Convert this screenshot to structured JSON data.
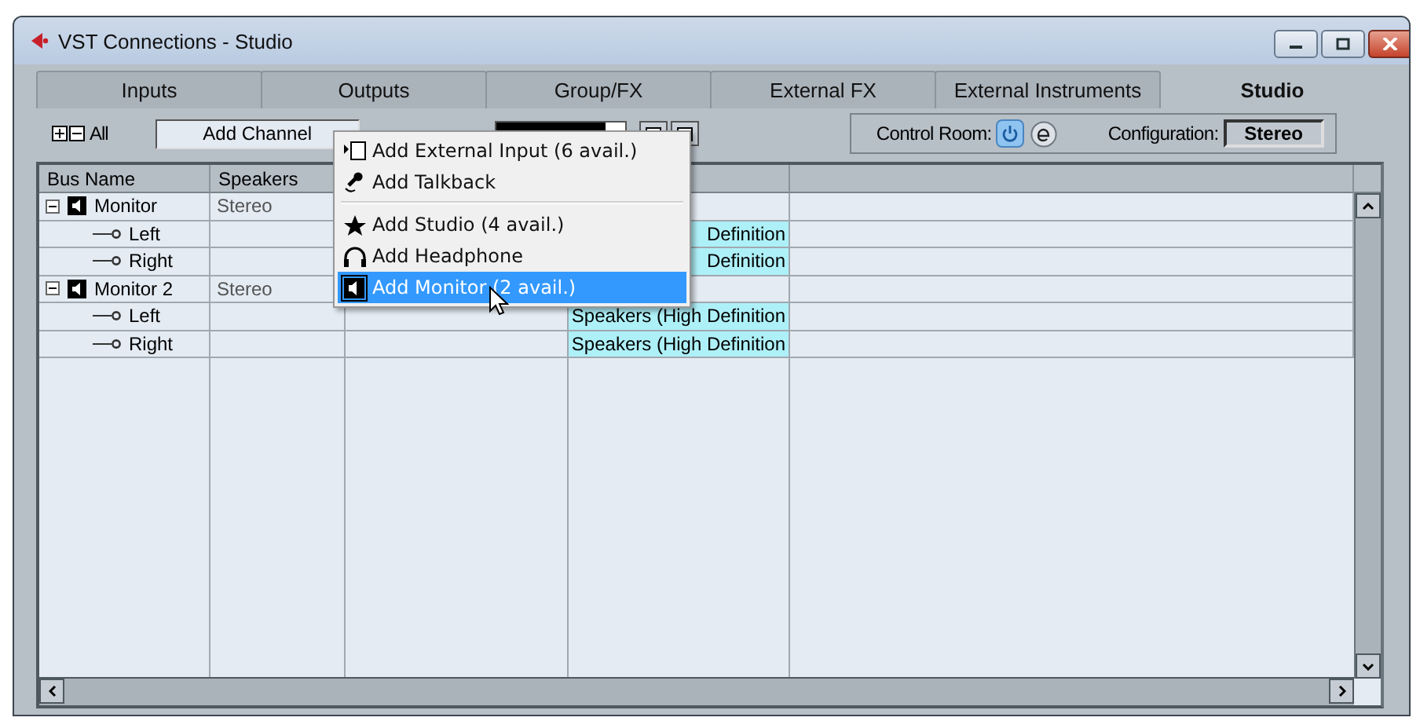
{
  "window": {
    "title": "VST Connections - Studio"
  },
  "tabs": [
    {
      "label": "Inputs",
      "selected": false
    },
    {
      "label": "Outputs",
      "selected": false
    },
    {
      "label": "Group/FX",
      "selected": false
    },
    {
      "label": "External FX",
      "selected": false
    },
    {
      "label": "External Instruments",
      "selected": false
    },
    {
      "label": "Studio",
      "selected": true
    }
  ],
  "toolbar": {
    "expand_all_label": "All",
    "add_button": "Add Channel",
    "control_room_label": "Control Room:",
    "control_room_on": true,
    "configuration_label": "Configuration:",
    "configuration_value": "Stereo"
  },
  "table": {
    "columns": [
      "Bus Name",
      "Speakers"
    ],
    "rows": [
      {
        "name": "Monitor",
        "speakers": "Stereo",
        "expanded": true,
        "children": [
          {
            "name": "Left",
            "column_4": "Definition"
          },
          {
            "name": "Right",
            "column_4": "Definition"
          }
        ]
      },
      {
        "name": "Monitor 2",
        "speakers": "Stereo",
        "expanded": true,
        "children": [
          {
            "name": "Left",
            "column_4": "Speakers (High Definition"
          },
          {
            "name": "Right",
            "column_4": "Speakers (High Definition"
          }
        ]
      }
    ]
  },
  "menu": {
    "items": [
      {
        "kind": "item",
        "label": "Add External Input (6 avail.)",
        "selected": false
      },
      {
        "kind": "item",
        "label": "Add Talkback",
        "selected": false
      },
      {
        "kind": "separator"
      },
      {
        "kind": "item",
        "label": "Add Studio (4 avail.)",
        "selected": false
      },
      {
        "kind": "item",
        "label": "Add Headphone",
        "selected": false
      },
      {
        "kind": "item",
        "label": "Add Monitor (2 avail.)",
        "selected": true
      }
    ]
  }
}
